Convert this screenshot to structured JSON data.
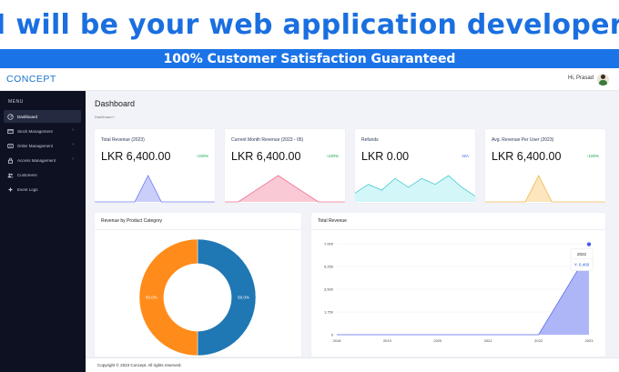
{
  "banner": {
    "headline": "I will be your web application developer",
    "tagline": "100% Customer Satisfaction Guaranteed"
  },
  "app": {
    "brand": "CONCEPT",
    "user_greeting": "Hi, Prasad"
  },
  "sidebar": {
    "menu_title": "MENU",
    "items": [
      {
        "label": "Dashboard",
        "icon": "dashboard-icon",
        "active": true,
        "has_submenu": false
      },
      {
        "label": "Stock Management",
        "icon": "stock-icon",
        "active": false,
        "has_submenu": true
      },
      {
        "label": "Order Management",
        "icon": "order-icon",
        "active": false,
        "has_submenu": true
      },
      {
        "label": "Access Management",
        "icon": "access-icon",
        "active": false,
        "has_submenu": true
      },
      {
        "label": "Customers",
        "icon": "customers-icon",
        "active": false,
        "has_submenu": false
      },
      {
        "label": "Event Logs",
        "icon": "event-logs-icon",
        "active": false,
        "has_submenu": false
      }
    ]
  },
  "page": {
    "title": "Dashboard",
    "breadcrumb": "Dashboard",
    "breadcrumb_sep": "›"
  },
  "cards": [
    {
      "title": "Total Revenue (2023)",
      "value": "LKR 6,400.00",
      "change": "↑100%",
      "color": "#6b7bf0",
      "fill": "#c9cefb",
      "spark": [
        0,
        0,
        0,
        0,
        10,
        0,
        0,
        0,
        0,
        0
      ]
    },
    {
      "title": "Current Month Revenue (2023 - 05)",
      "value": "LKR 6,400.00",
      "change": "↑100%",
      "color": "#f06a8a",
      "fill": "#f9c9d6",
      "spark": [
        0,
        0,
        3,
        6,
        9,
        6,
        3,
        0,
        0,
        0
      ]
    },
    {
      "title": "Refunds",
      "value": "LKR 0.00",
      "change": "N/A",
      "color": "#42c9d0",
      "fill": "#d3f6f8",
      "spark": [
        3,
        6,
        4,
        8,
        5,
        8,
        6,
        9,
        5,
        2
      ]
    },
    {
      "title": "Avg. Revenue Per User (2023)",
      "value": "LKR 6,400.00",
      "change": "↑100%",
      "color": "#f2b54a",
      "fill": "#fbe6bd",
      "spark": [
        0,
        0,
        0,
        0,
        10,
        0,
        0,
        0,
        0,
        0
      ]
    }
  ],
  "donut_panel": {
    "title": "Revenue by Product Category",
    "chart_data": {
      "type": "pie",
      "hole": 0.58,
      "slices": [
        {
          "label": "50.0%",
          "value": 50,
          "color": "#1f77b4"
        },
        {
          "label": "50.0%",
          "value": 50,
          "color": "#ff8c1a"
        }
      ]
    }
  },
  "revenue_panel": {
    "title": "Total Revenue",
    "tooltip_year": "2022",
    "tooltip_value": "Y: 6,400",
    "chart_data": {
      "type": "area",
      "x": [
        2018,
        2019,
        2020,
        2021,
        2022,
        2023
      ],
      "series": [
        {
          "values": [
            0,
            0,
            0,
            0,
            0,
            6400
          ],
          "color": "#5b6cf0",
          "fill": "#aeb6f7"
        }
      ],
      "ylim": [
        0,
        7000
      ],
      "yticks": [
        0,
        1750,
        3500,
        5250,
        7000
      ],
      "ytick_labels": [
        "0",
        "1,750",
        "3,500",
        "5,250",
        "7,000"
      ],
      "xtick_labels": [
        "2018",
        "2019",
        "2020",
        "2021",
        "2022",
        "2023"
      ]
    }
  },
  "footer": {
    "text": "Copyright © 2023 Concept. All rights reserved."
  }
}
